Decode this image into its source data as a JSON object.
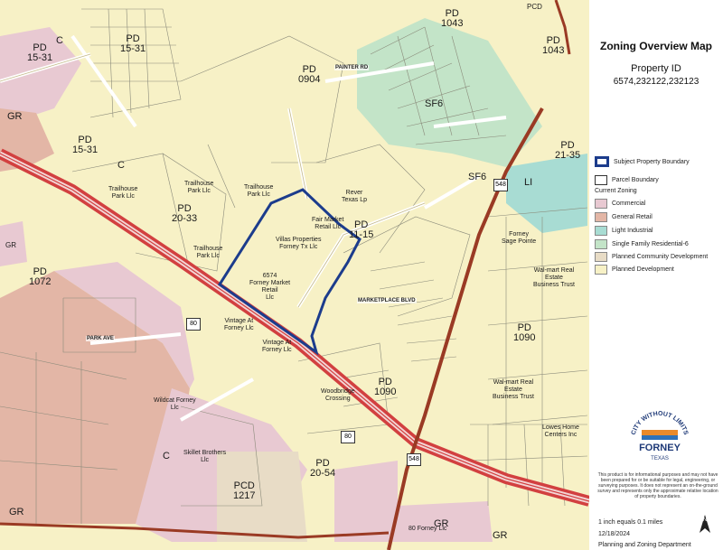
{
  "title": "Zoning Overview Map",
  "property": {
    "label": "Property ID",
    "ids": "6574,232122,232123"
  },
  "legend": {
    "subject": "Subject Property Boundary",
    "parcel": "Parcel Boundary",
    "heading": "Current Zoning",
    "items": [
      {
        "label": "Commercial",
        "color": "#e8c9d2"
      },
      {
        "label": "General Retail",
        "color": "#e3b6a6"
      },
      {
        "label": "Light Industrial",
        "color": "#a8dcd3"
      },
      {
        "label": "Single Family Residential-6",
        "color": "#c3e4c8"
      },
      {
        "label": "Planned Community Development",
        "color": "#e8dcc6"
      },
      {
        "label": "Planned Development",
        "color": "#f7f1c6"
      }
    ]
  },
  "colors": {
    "subject": "#1c3c8c",
    "highway": "#d24040",
    "road": "#9a3a24"
  },
  "logo": {
    "arc": "CITY WITHOUT LIMITS",
    "name": "FORNEY",
    "state": "TEXAS"
  },
  "disclaimer": "This product is for informational purposes and may not have been prepared for or be suitable for legal, engineering, or surveying purposes. It does not represent an on-the-ground survey and represents only the approximate relative location of property boundaries.",
  "scale": "1 inch equals 0.1 miles",
  "date": "12/18/2024",
  "department": "Planning and Zoning Department",
  "north": "N",
  "zones": [
    {
      "text": "PD\n15-31",
      "id": "z1"
    },
    {
      "text": "C",
      "id": "z2"
    },
    {
      "text": "PD\n15-31",
      "id": "z3"
    },
    {
      "text": "PD\n15-31",
      "id": "z4"
    },
    {
      "text": "PD\n0904",
      "id": "z5"
    },
    {
      "text": "SF6",
      "id": "z6"
    },
    {
      "text": "PD\n1043",
      "id": "z7"
    },
    {
      "text": "PD\n1043",
      "id": "z8"
    },
    {
      "text": "PCD",
      "id": "z9"
    },
    {
      "text": "GR",
      "id": "z10"
    },
    {
      "text": "C",
      "id": "z11"
    },
    {
      "text": "PD\n20-33",
      "id": "z12"
    },
    {
      "text": "PD\n11-15",
      "id": "z13"
    },
    {
      "text": "SF6",
      "id": "z14"
    },
    {
      "text": "LI",
      "id": "z15"
    },
    {
      "text": "PD\n21-35",
      "id": "z16"
    },
    {
      "text": "PD\n1072",
      "id": "z17"
    },
    {
      "text": "PD\n1090",
      "id": "z18"
    },
    {
      "text": "PD\n1090",
      "id": "z19"
    },
    {
      "text": "C",
      "id": "z20"
    },
    {
      "text": "PD\n20-54",
      "id": "z21"
    },
    {
      "text": "PCD\n1217",
      "id": "z22"
    },
    {
      "text": "GR",
      "id": "z23"
    },
    {
      "text": "GR",
      "id": "z24"
    },
    {
      "text": "GR",
      "id": "z25"
    },
    {
      "text": "GR",
      "id": "z26"
    }
  ],
  "parcels": [
    {
      "text": "Fair Market\nRetail Llc",
      "id": "p1"
    },
    {
      "text": "Villas Properties\nForney Tx Llc",
      "id": "p2"
    },
    {
      "text": "6574\nForney Market\nRetail\nLlc",
      "id": "p3"
    },
    {
      "text": "Rever\nTexas Lp",
      "id": "p4"
    },
    {
      "text": "Trailhouse\nPark Llc",
      "id": "p5"
    },
    {
      "text": "Trailhouse\nPark Llc",
      "id": "p6"
    },
    {
      "text": "Trailhouse\nPark Llc",
      "id": "p7"
    },
    {
      "text": "Trailhouse\nPark Llc",
      "id": "p8"
    },
    {
      "text": "Vintage At\nForney Llc",
      "id": "p9"
    },
    {
      "text": "Vintage At\nForney Llc",
      "id": "p10"
    },
    {
      "text": "Wal-mart Real\nEstate\nBusiness Trust",
      "id": "p11"
    },
    {
      "text": "Wal-mart Real\nEstate\nBusiness Trust",
      "id": "p12"
    },
    {
      "text": "Skillet Brothers\nLlc",
      "id": "p13"
    },
    {
      "text": "Wildcat Forney\nLlc",
      "id": "p14"
    },
    {
      "text": "80 Forney Llc",
      "id": "p15"
    },
    {
      "text": "Lowes Home\nCenters Inc",
      "id": "p16"
    },
    {
      "text": "Forney\nSage Pointe",
      "id": "p17"
    },
    {
      "text": "Woodbridge\nCrossing",
      "id": "p18"
    }
  ],
  "roads": [
    {
      "text": "HWY 80",
      "id": "r1"
    },
    {
      "text": "80",
      "id": "r2"
    },
    {
      "text": "PAINTER RD",
      "id": "r3"
    },
    {
      "text": "MARKETPLACE BLVD",
      "id": "r4"
    },
    {
      "text": "PARK AVE",
      "id": "r5"
    },
    {
      "text": "FM 548",
      "id": "r6"
    },
    {
      "text": "548",
      "id": "r7"
    },
    {
      "text": "548",
      "id": "r8"
    }
  ]
}
